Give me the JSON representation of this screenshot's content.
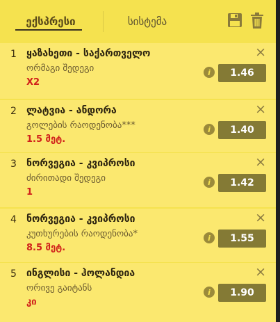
{
  "tabs": [
    {
      "label": "ექსპრესი",
      "active": true
    },
    {
      "label": "სისტემა",
      "active": false
    }
  ],
  "toolbar": {
    "save_icon": "save-icon",
    "delete_icon": "trash-icon"
  },
  "bets": [
    {
      "index": "1",
      "match": "ყაზახეთი - საქართველო",
      "market": "ორმაგი შედეგი",
      "pick": "X2",
      "odds": "1.46"
    },
    {
      "index": "2",
      "match": "ლატვია - ანდორა",
      "market": "გოლების რაოდენობა***",
      "pick": "1.5 მეტ.",
      "odds": "1.40"
    },
    {
      "index": "3",
      "match": "ნორვეგია - კვიპროსი",
      "market": "ძირითადი შედეგი",
      "pick": "1",
      "odds": "1.42"
    },
    {
      "index": "4",
      "match": "ნორვეგია - კვიპროსი",
      "market": "კუთხურების რაოდენობა*",
      "pick": "8.5 მეტ.",
      "odds": "1.55"
    },
    {
      "index": "5",
      "match": "ინგლისი - ჰოლანდია",
      "market": "ორივე გაიტანს",
      "pick": "კი",
      "odds": "1.90"
    }
  ],
  "info_glyph": "i",
  "close_glyph": "×",
  "colors": {
    "panel": "#f5e24f",
    "item": "#fbe86f",
    "odds_bg": "#847a35",
    "pick": "#d0201b"
  }
}
